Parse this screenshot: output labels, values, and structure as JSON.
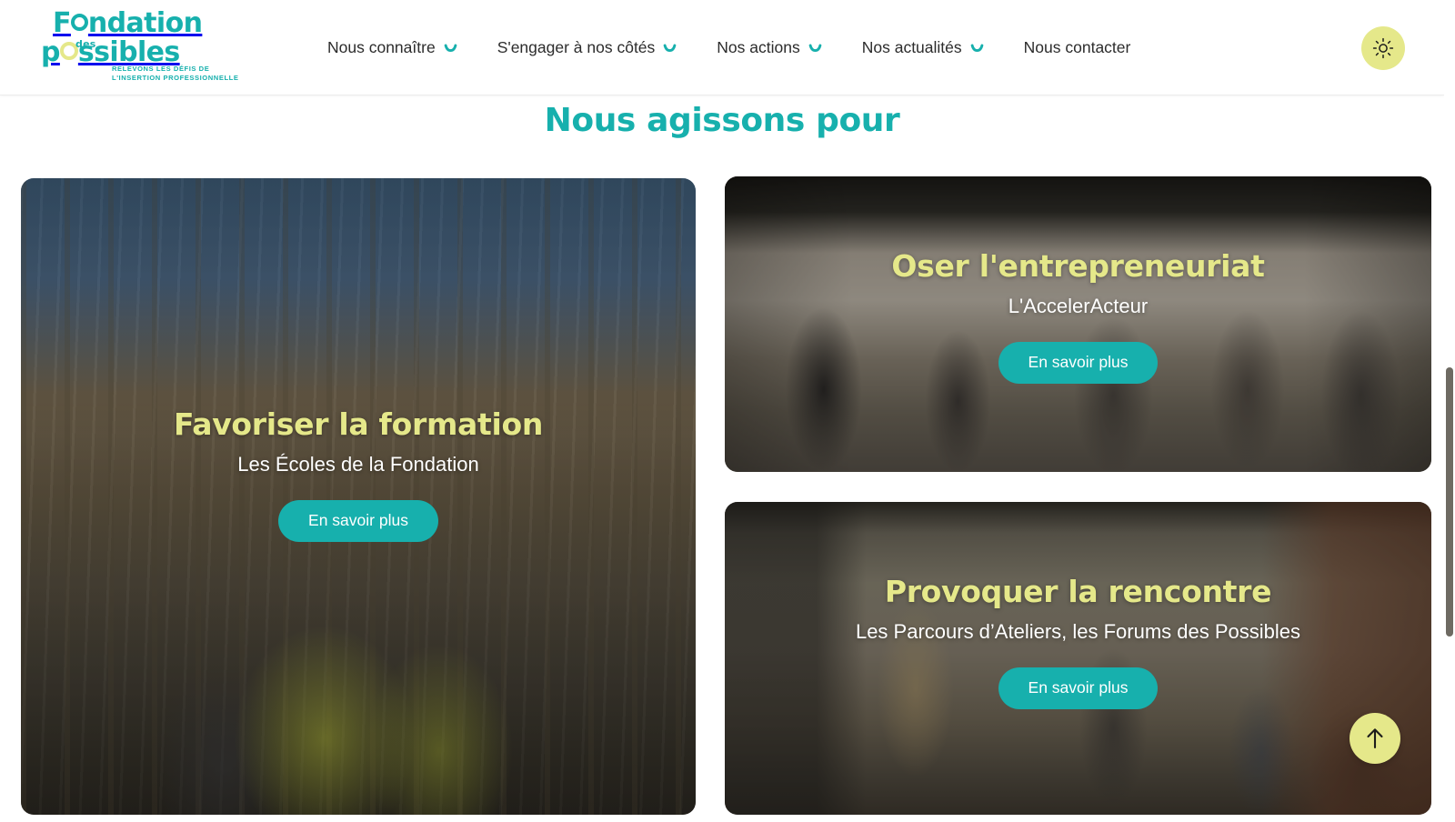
{
  "site": {
    "logo": {
      "line1": "F ndation",
      "line2": "p ssibles",
      "middle_word": "des",
      "tagline": "RELEVONS LES DÉFIS DE\nL'INSERTION PROFESSIONNELLE",
      "tagline_line1": "RELEVONS LES DÉFIS DE",
      "tagline_line2": "L'INSERTION PROFESSIONNELLE",
      "color_teal": "#17b0ad",
      "color_yellow": "#e5e88a"
    }
  },
  "header": {
    "nav": [
      {
        "label": "Nous connaître",
        "has_dropdown": true
      },
      {
        "label": "S'engager à nos côtés",
        "has_dropdown": true
      },
      {
        "label": "Nos actions",
        "has_dropdown": true
      },
      {
        "label": "Nos actualités",
        "has_dropdown": true
      },
      {
        "label": "Nous contacter",
        "has_dropdown": false
      }
    ],
    "theme_toggle": {
      "icon": "sun-icon",
      "background": "#e5e88a"
    }
  },
  "main": {
    "section_title": "Nous agissons pour",
    "cards": [
      {
        "id": "formation",
        "title": "Favoriser la formation",
        "subtitle": "Les Écoles de la Fondation",
        "button_label": "En savoir plus"
      },
      {
        "id": "entrepreneuriat",
        "title": "Oser l'entrepreneuriat",
        "subtitle": "L'AccelerActeur",
        "button_label": "En savoir plus"
      },
      {
        "id": "rencontre",
        "title": "Provoquer la rencontre",
        "subtitle": "Les Parcours d’Ateliers, les Forums des Possibles",
        "button_label": "En savoir plus"
      }
    ]
  },
  "floating": {
    "scroll_top": {
      "icon": "arrow-up-icon",
      "background": "#e5e88a"
    }
  },
  "colors": {
    "accent_teal": "#17b0ad",
    "accent_yellow": "#e5e88a",
    "text_dark": "#2c2c2c",
    "page_background": "#ffffff"
  }
}
